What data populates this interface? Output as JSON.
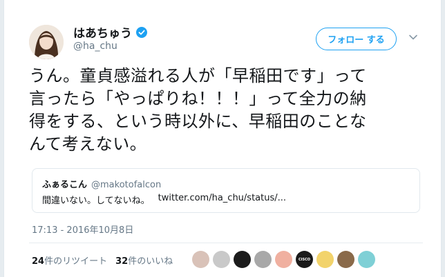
{
  "author": {
    "display_name": "はあちゅう",
    "handle": "@ha_chu",
    "verified": true
  },
  "follow_button": {
    "label": "フォロー する"
  },
  "tweet": {
    "lines": [
      "うん。童貞感溢れる人が「早稲田です」って",
      "言ったら「やっぱりね！！！」って全力の納",
      "得をする、という時以外に、早稲田のことな",
      "んて考えない。"
    ]
  },
  "quoted_tweet": {
    "display_name": "ふぁるこん",
    "handle": "@makotofalcon",
    "text": "間違いない。してないね。",
    "link": "twitter.com/ha_chu/status/..."
  },
  "timestamp": "17:13 - 2016年10月8日",
  "stats": {
    "retweets_count": "24",
    "retweets_label": "件のリツイート",
    "likes_count": "32",
    "likes_label": "件のいいね"
  },
  "likers": [
    {
      "name": "liker-1",
      "color": "#d9c2b8"
    },
    {
      "name": "liker-2",
      "color": "#c9c9c9"
    },
    {
      "name": "liker-3",
      "color": "#1c1c1c"
    },
    {
      "name": "liker-4",
      "color": "#a8a8a8"
    },
    {
      "name": "liker-5",
      "color": "#f0b0a0"
    },
    {
      "name": "liker-6",
      "color": "#1a1a1a",
      "text": "CISCO"
    },
    {
      "name": "liker-7",
      "color": "#f2d36b"
    },
    {
      "name": "liker-8",
      "color": "#8a6a4a"
    },
    {
      "name": "liker-9",
      "color": "#7fd0d6"
    }
  ],
  "colors": {
    "accent": "#1da1f2",
    "muted": "#657786",
    "text": "#14171a"
  }
}
